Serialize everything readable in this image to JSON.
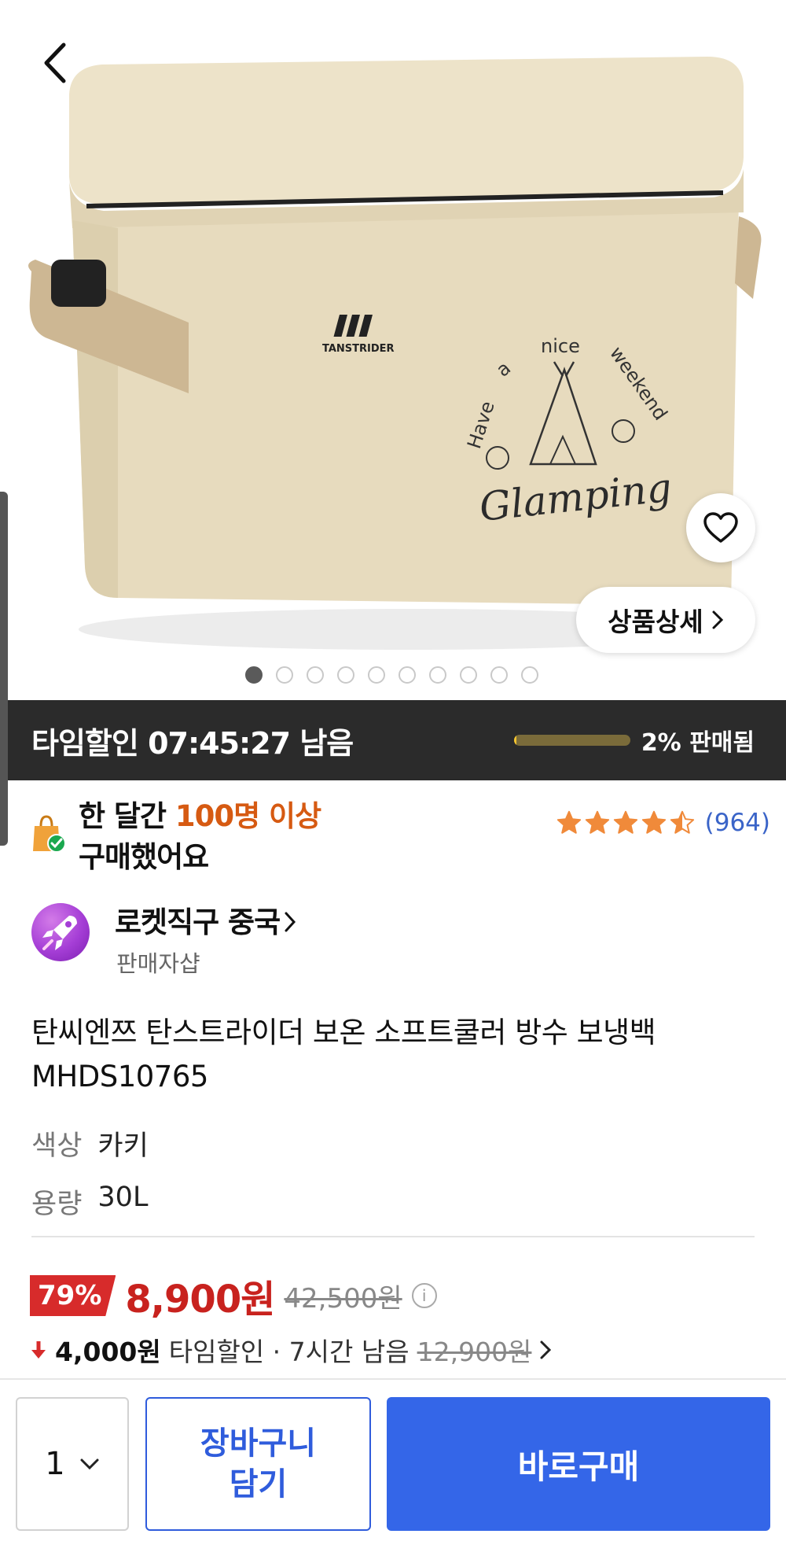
{
  "hero": {
    "brand_text": "TANSTRIDER",
    "print_words": [
      "Have",
      "a",
      "nice",
      "weekend"
    ],
    "print_script": "Glamping",
    "detail_label": "상품상세",
    "slides_total": 10,
    "slide_active": 1
  },
  "timesale": {
    "title": "타임할인 07:45:27 남음",
    "sold_label": "2% 판매됨",
    "sold_fraction": 0.02
  },
  "proof": {
    "line1_pre": "한 달간 ",
    "line1_highlight": "100명 이상",
    "line2": "구매했어요",
    "rating": 4.5,
    "review_count": "(964)"
  },
  "seller": {
    "name": "로켓직구 중국",
    "sub": "판매자샵"
  },
  "product": {
    "title": "탄씨엔쯔 탄스트라이더 보온 소프트쿨러 방수 보냉백 MHDS10765",
    "options": [
      {
        "key": "색상",
        "value": "카키"
      },
      {
        "key": "용량",
        "value": "30L"
      }
    ]
  },
  "price": {
    "discount": "79%",
    "current": "8,900원",
    "original": "42,500원",
    "deal_amount": "4,000원",
    "deal_label": "타임할인 · 7시간 남음",
    "deal_original": "12,900원"
  },
  "bottom": {
    "qty": "1",
    "cart_line1": "장바구니",
    "cart_line2": "담기",
    "buy_label": "바로구매"
  },
  "colors": {
    "accent_blue": "#3466e8",
    "price_red": "#c8221e",
    "highlight_orange": "#d65a12",
    "star_orange": "#f08a3a",
    "product_beige": "#e8dcc0"
  }
}
